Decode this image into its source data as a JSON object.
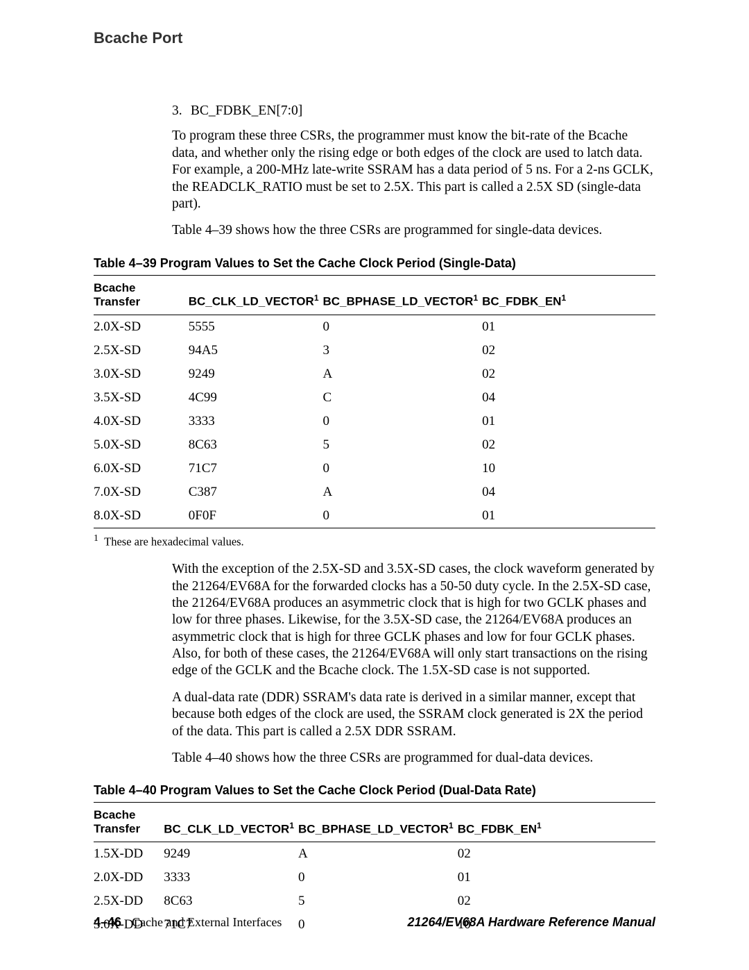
{
  "header": {
    "section_title": "Bcache Port"
  },
  "list_item3": {
    "number": "3.",
    "text": "BC_FDBK_EN[7:0]"
  },
  "para1": "To program these three CSRs, the programmer must know the bit-rate of the Bcache data, and whether only the rising edge or both edges of the clock are used to latch data. For example, a 200-MHz late-write SSRAM has a data period of 5 ns.  For a 2-ns GCLK, the READCLK_RATIO must be set to 2.5X. This part is called a 2.5X SD (single-data part).",
  "para2": "Table 4–39 shows how the three CSRs are programmed for single-data devices.",
  "table39": {
    "caption": "Table 4–39  Program Values to Set the Cache Clock Period (Single-Data)",
    "headers": {
      "h1": "Bcache Transfer",
      "h2": "BC_CLK_LD_VECTOR",
      "h3": "BC_BPHASE_LD_VECTOR",
      "h4": "BC_FDBK_EN"
    },
    "rows": [
      {
        "c1": "2.0X-SD",
        "c2": "5555",
        "c3": "0",
        "c4": "01"
      },
      {
        "c1": "2.5X-SD",
        "c2": "94A5",
        "c3": "3",
        "c4": "02"
      },
      {
        "c1": "3.0X-SD",
        "c2": "9249",
        "c3": "A",
        "c4": "02"
      },
      {
        "c1": "3.5X-SD",
        "c2": "4C99",
        "c3": "C",
        "c4": "04"
      },
      {
        "c1": "4.0X-SD",
        "c2": "3333",
        "c3": "0",
        "c4": "01"
      },
      {
        "c1": "5.0X-SD",
        "c2": "8C63",
        "c3": "5",
        "c4": "02"
      },
      {
        "c1": "6.0X-SD",
        "c2": "71C7",
        "c3": "0",
        "c4": "10"
      },
      {
        "c1": "7.0X-SD",
        "c2": "C387",
        "c3": "A",
        "c4": "04"
      },
      {
        "c1": "8.0X-SD",
        "c2": "0F0F",
        "c3": "0",
        "c4": "01"
      }
    ],
    "footnote_marker": "1",
    "footnote_text": "These are hexadecimal values."
  },
  "para3": "With the exception of the 2.5X-SD and 3.5X-SD cases, the clock waveform generated by the 21264/EV68A for the forwarded clocks has a 50-50 duty cycle. In the 2.5X-SD case, the 21264/EV68A produces an asymmetric clock that is high for two GCLK phases and low for three phases. Likewise, for the 3.5X-SD case, the 21264/EV68A produces an asymmetric clock that is high for three GCLK phases and low for four GCLK phases. Also, for both of these cases, the 21264/EV68A will only start transactions on the rising edge of the GCLK and the Bcache clock. The 1.5X-SD case is not supported.",
  "para4": "A dual-data rate (DDR) SSRAM's data rate is derived in a similar manner, except that because both edges of the clock are used, the SSRAM clock generated is 2X the period of the data. This part is called a 2.5X DDR SSRAM.",
  "para5": "Table 4–40 shows how the three CSRs are programmed for dual-data devices.",
  "table40": {
    "caption": "Table 4–40  Program Values to Set the Cache Clock Period (Dual-Data Rate)",
    "headers": {
      "h1a": "Bcache",
      "h1b": "Transfer",
      "h2": "BC_CLK_LD_VECTOR",
      "h3": "BC_BPHASE_LD_VECTOR",
      "h4": "BC_FDBK_EN"
    },
    "rows": [
      {
        "c1": "1.5X-DD",
        "c2": "9249",
        "c3": "A",
        "c4": "02"
      },
      {
        "c1": "2.0X-DD",
        "c2": "3333",
        "c3": "0",
        "c4": "01"
      },
      {
        "c1": "2.5X-DD",
        "c2": "8C63",
        "c3": "5",
        "c4": "02"
      },
      {
        "c1": "3.0X-DD",
        "c2": "71C7",
        "c3": "0",
        "c4": "10"
      }
    ]
  },
  "footer": {
    "page_number": "4–46",
    "chapter_title": "Cache and External Interfaces",
    "manual_title": "21264/EV68A Hardware Reference Manual"
  }
}
